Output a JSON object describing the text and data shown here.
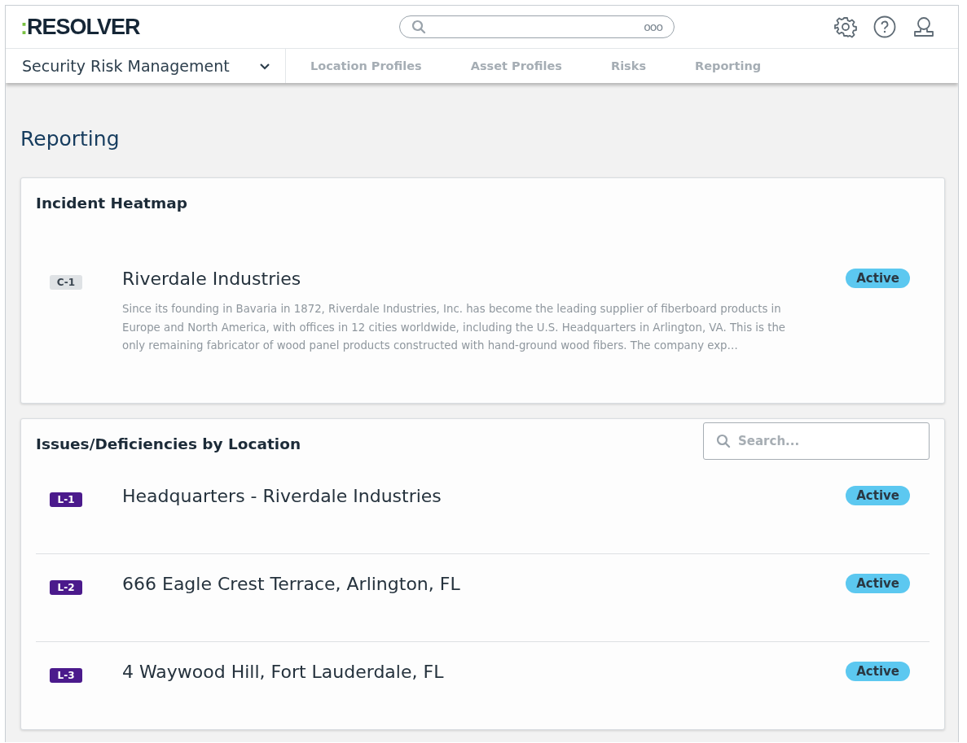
{
  "header": {
    "logo_mark": ":",
    "logo_text": "RESOLVER",
    "search": {
      "more": "ooo"
    }
  },
  "nav": {
    "app": "Security Risk Management",
    "tabs": [
      {
        "label": "Location Profiles"
      },
      {
        "label": "Asset Profiles"
      },
      {
        "label": "Risks"
      },
      {
        "label": "Reporting"
      }
    ]
  },
  "page_title": "Reporting",
  "cards": [
    {
      "title": "Incident Heatmap",
      "items": [
        {
          "badge": "C-1",
          "color": "#dfe2e5",
          "name": "Riverdale Industries",
          "description": "Since its founding in Bavaria in 1872, Riverdale Industries, Inc. has become the leading supplier of fiberboard products in Europe and North America, with offices in 12 cities worldwide, including the U.S. Headquarters in Arlington, VA. This is the only remaining fabricator of wood panel products constructed with hand-ground wood fibers. The company exp…",
          "status": "Active"
        }
      ]
    },
    {
      "title": "Issues/Deficiencies by Location",
      "search": {
        "placeholder": "Search..."
      },
      "items": [
        {
          "badge": "L-1",
          "color": "#4b1a8c",
          "name": "Headquarters - Riverdale Industries",
          "status": "Active"
        },
        {
          "badge": "L-2",
          "color": "#4b1a8c",
          "name": "666 Eagle Crest Terrace, Arlington, FL",
          "status": "Active"
        },
        {
          "badge": "L-3",
          "color": "#4b1a8c",
          "name": "4 Waywood Hill, Fort Lauderdale, FL",
          "status": "Active"
        }
      ]
    }
  ]
}
